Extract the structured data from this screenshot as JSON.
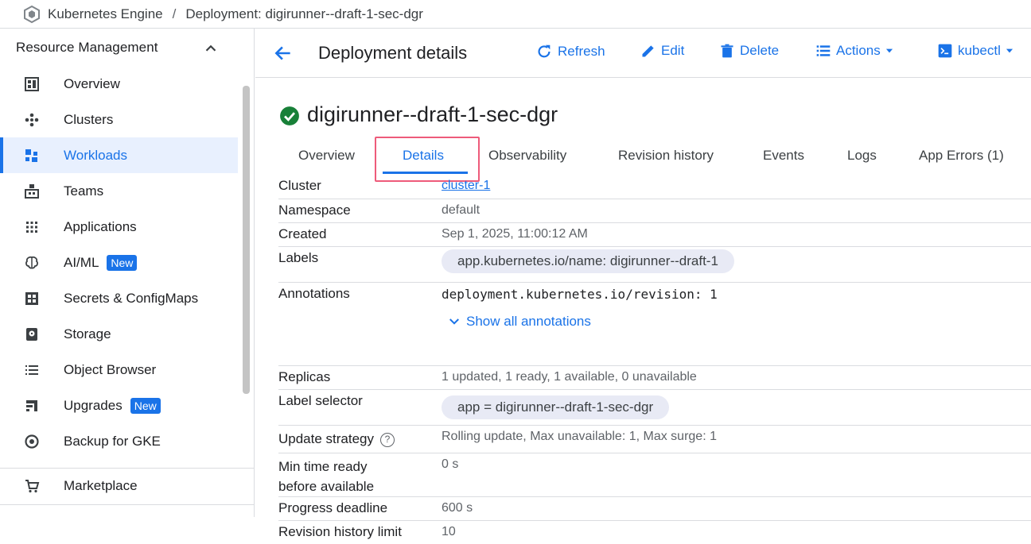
{
  "breadcrumb": {
    "product": "Kubernetes Engine",
    "separator": "/",
    "page": "Deployment: digirunner--draft-1-sec-dgr"
  },
  "sidebar": {
    "section_title": "Resource Management",
    "items": [
      {
        "label": "Overview",
        "icon": "dashboard-icon"
      },
      {
        "label": "Clusters",
        "icon": "clusters-icon"
      },
      {
        "label": "Workloads",
        "icon": "workloads-icon",
        "active": true
      },
      {
        "label": "Teams",
        "icon": "teams-icon"
      },
      {
        "label": "Applications",
        "icon": "apps-grid-icon"
      },
      {
        "label": "AI/ML",
        "icon": "brain-icon",
        "badge": "New"
      },
      {
        "label": "Secrets & ConfigMaps",
        "icon": "grid-icon"
      },
      {
        "label": "Storage",
        "icon": "storage-icon"
      },
      {
        "label": "Object Browser",
        "icon": "list-icon"
      },
      {
        "label": "Upgrades",
        "icon": "upgrades-icon",
        "badge": "New"
      },
      {
        "label": "Backup for GKE",
        "icon": "backup-icon"
      }
    ],
    "marketplace": "Marketplace"
  },
  "toolbar": {
    "title": "Deployment details",
    "refresh": "Refresh",
    "edit": "Edit",
    "delete": "Delete",
    "actions": "Actions",
    "kubectl": "kubectl"
  },
  "resource": {
    "name": "digirunner--draft-1-sec-dgr",
    "status": "ok"
  },
  "tabs": [
    "Overview",
    "Details",
    "Observability",
    "Revision history",
    "Events",
    "Logs",
    "App Errors (1)"
  ],
  "details": {
    "cluster_label": "Cluster",
    "cluster_value": "cluster-1",
    "namespace_label": "Namespace",
    "namespace_value": "default",
    "created_label": "Created",
    "created_value": "Sep 1, 2025, 11:00:12 AM",
    "labels_label": "Labels",
    "labels_value": "app.kubernetes.io/name: digirunner--draft-1",
    "annotations_label": "Annotations",
    "annotations_value": "deployment.kubernetes.io/revision: 1",
    "show_all_annotations": "Show all annotations",
    "replicas_label": "Replicas",
    "replicas_value": "1 updated, 1 ready, 1 available, 0 unavailable",
    "label_selector_label": "Label selector",
    "label_selector_value": "app = digirunner--draft-1-sec-dgr",
    "update_strategy_label": "Update strategy",
    "update_strategy_value": "Rolling update, Max unavailable: 1, Max surge: 1",
    "min_time_label_1": "Min time ready",
    "min_time_label_2": "before available",
    "min_time_value": "0 s",
    "progress_deadline_label": "Progress deadline",
    "progress_deadline_value": "600 s",
    "revision_limit_label": "Revision history limit",
    "revision_limit_value": "10"
  },
  "colors": {
    "accent": "#1a73e8",
    "success": "#188038",
    "highlight": "#ee5b7a"
  }
}
